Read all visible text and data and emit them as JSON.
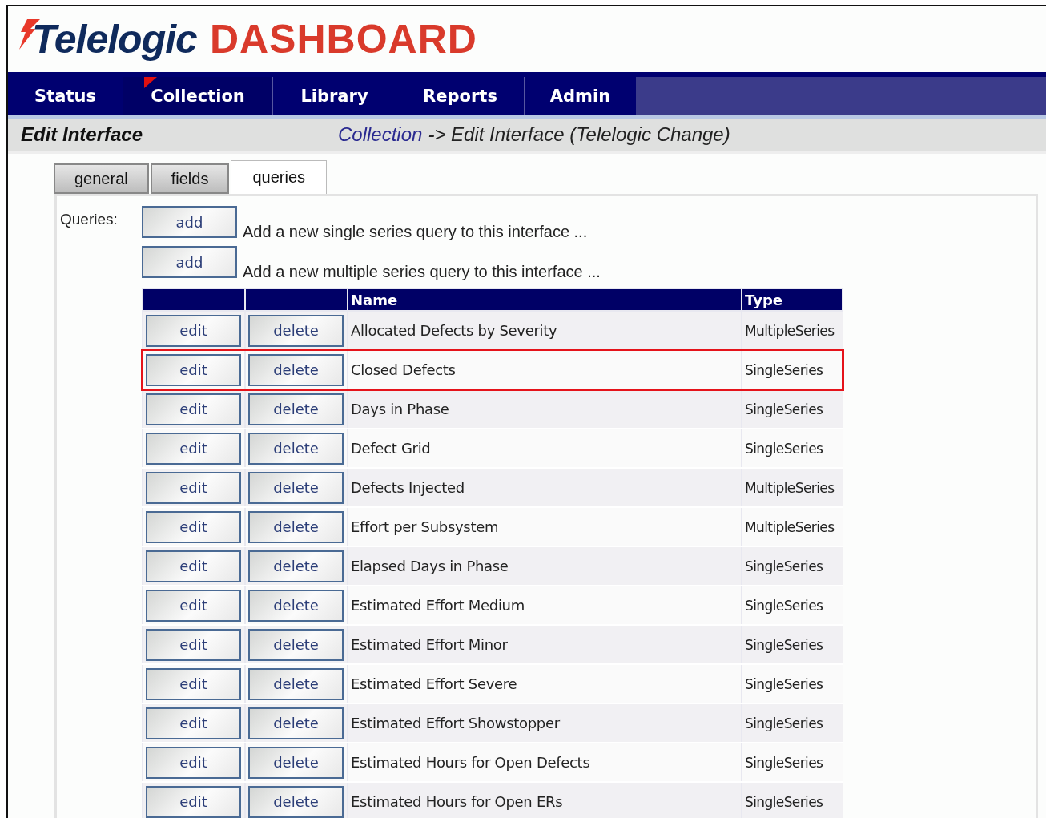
{
  "header": {
    "brand": "Telelogic",
    "product": "DASHBOARD"
  },
  "nav": [
    {
      "label": "Status",
      "selected": false
    },
    {
      "label": "Collection",
      "selected": true
    },
    {
      "label": "Library",
      "selected": false
    },
    {
      "label": "Reports",
      "selected": false
    },
    {
      "label": "Admin",
      "selected": false
    }
  ],
  "title_bar": {
    "title": "Edit Interface",
    "breadcrumb_link": "Collection",
    "breadcrumb_rest": "-> Edit Interface (Telelogic Change)"
  },
  "tabs": [
    {
      "label": "general",
      "selected": false
    },
    {
      "label": "fields",
      "selected": false
    },
    {
      "label": "queries",
      "selected": true
    }
  ],
  "queries_label": "Queries:",
  "add_actions": [
    {
      "button": "add",
      "description": "Add a new single series query to this interface ..."
    },
    {
      "button": "add",
      "description": "Add a new multiple series query to this interface ..."
    }
  ],
  "table": {
    "columns": [
      "",
      "",
      "Name",
      "Type"
    ],
    "rows": [
      {
        "edit": "edit",
        "delete": "delete",
        "name": "Allocated Defects by Severity",
        "type": "MultipleSeries",
        "highlighted": false
      },
      {
        "edit": "edit",
        "delete": "delete",
        "name": "Closed Defects",
        "type": "SingleSeries",
        "highlighted": true
      },
      {
        "edit": "edit",
        "delete": "delete",
        "name": "Days in Phase",
        "type": "SingleSeries",
        "highlighted": false
      },
      {
        "edit": "edit",
        "delete": "delete",
        "name": "Defect Grid",
        "type": "SingleSeries",
        "highlighted": false
      },
      {
        "edit": "edit",
        "delete": "delete",
        "name": "Defects Injected",
        "type": "MultipleSeries",
        "highlighted": false
      },
      {
        "edit": "edit",
        "delete": "delete",
        "name": "Effort per Subsystem",
        "type": "MultipleSeries",
        "highlighted": false
      },
      {
        "edit": "edit",
        "delete": "delete",
        "name": "Elapsed Days in Phase",
        "type": "SingleSeries",
        "highlighted": false
      },
      {
        "edit": "edit",
        "delete": "delete",
        "name": "Estimated Effort Medium",
        "type": "SingleSeries",
        "highlighted": false
      },
      {
        "edit": "edit",
        "delete": "delete",
        "name": "Estimated Effort Minor",
        "type": "SingleSeries",
        "highlighted": false
      },
      {
        "edit": "edit",
        "delete": "delete",
        "name": "Estimated Effort Severe",
        "type": "SingleSeries",
        "highlighted": false
      },
      {
        "edit": "edit",
        "delete": "delete",
        "name": "Estimated Effort Showstopper",
        "type": "SingleSeries",
        "highlighted": false
      },
      {
        "edit": "edit",
        "delete": "delete",
        "name": "Estimated Hours for Open Defects",
        "type": "SingleSeries",
        "highlighted": false
      },
      {
        "edit": "edit",
        "delete": "delete",
        "name": "Estimated Hours for Open ERs",
        "type": "SingleSeries",
        "highlighted": false
      }
    ]
  }
}
